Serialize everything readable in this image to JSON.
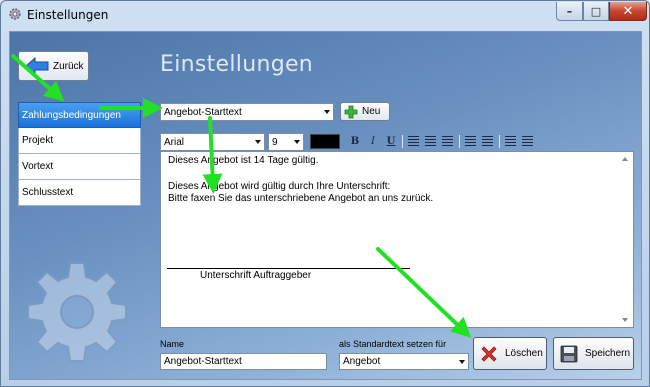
{
  "window": {
    "title": "Einstellungen"
  },
  "titlebar_buttons": {
    "minimize": "–",
    "maximize": "□",
    "close": "✕"
  },
  "header": {
    "back_label": "Zurück",
    "title": "Einstellungen"
  },
  "sidebar": {
    "items": [
      {
        "label": "Zahlungsbedingungen",
        "active": true
      },
      {
        "label": "Projekt",
        "active": false
      },
      {
        "label": "Vortext",
        "active": false
      },
      {
        "label": "Schlusstext",
        "active": false
      }
    ]
  },
  "template_select": {
    "value": "Angebot-Starttext"
  },
  "new_button": {
    "label": "Neu"
  },
  "format_toolbar": {
    "font": "Arial",
    "size": "9",
    "text_color": "#000000",
    "bold": "B",
    "italic": "I",
    "underline": "U"
  },
  "editor": {
    "lines": [
      "Dieses Angebot ist 14 Tage gültig.",
      "Dieses Angebot wird gültig durch Ihre Unterschrift:",
      "Bitte faxen Sie das unterschriebene Angebot an uns zurück."
    ],
    "signature_caption": "Unterschrift Auftraggeber"
  },
  "form": {
    "name_label": "Name",
    "name_value": "Angebot-Starttext",
    "default_label": "als Standardtext setzen für",
    "default_value": "Angebot"
  },
  "actions": {
    "delete_label": "Löschen",
    "save_label": "Speichern"
  },
  "colors": {
    "accent": "#1a72d8",
    "arrow": "#22e024"
  }
}
